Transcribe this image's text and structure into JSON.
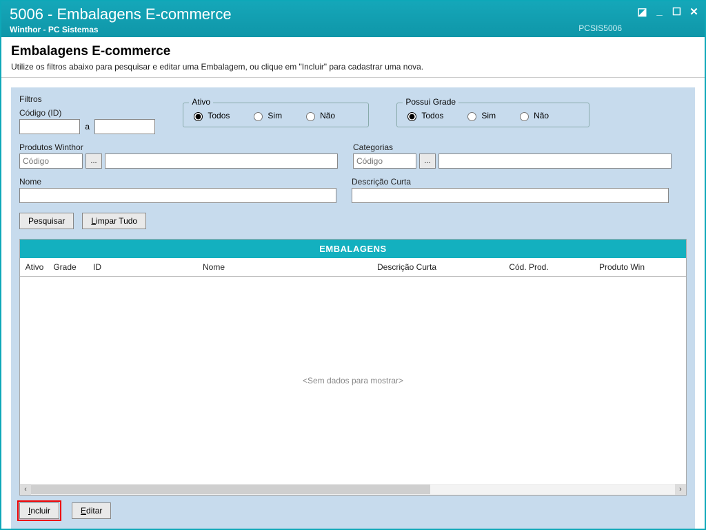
{
  "window": {
    "title": "5006 - Embalagens E-commerce",
    "subtitle": "Winthor - PC Sistemas",
    "module_code": "PCSIS5006"
  },
  "page": {
    "heading": "Embalagens E-commerce",
    "instruction": "Utilize os filtros abaixo para pesquisar e editar uma Embalagem, ou clique em \"Incluir\" para cadastrar uma nova."
  },
  "filters": {
    "legend": "Filtros",
    "codigo_label": "Código (ID)",
    "codigo_from": "",
    "codigo_sep": "a",
    "codigo_to": "",
    "ativo": {
      "legend": "Ativo",
      "options": {
        "todos": "Todos",
        "sim": "Sim",
        "nao": "Não"
      },
      "selected": "todos"
    },
    "grade": {
      "legend": "Possui Grade",
      "options": {
        "todos": "Todos",
        "sim": "Sim",
        "nao": "Não"
      },
      "selected": "todos"
    },
    "produtos": {
      "label": "Produtos Winthor",
      "code_placeholder": "Código",
      "code": "",
      "desc": ""
    },
    "categorias": {
      "label": "Categorias",
      "code_placeholder": "Código",
      "code": "",
      "desc": ""
    },
    "nome": {
      "label": "Nome",
      "value": ""
    },
    "descricao": {
      "label": "Descrição Curta",
      "value": ""
    },
    "buttons": {
      "pesquisar": "Pesquisar",
      "limpar": "Limpar Tudo"
    }
  },
  "grid": {
    "title": "EMBALAGENS",
    "columns": {
      "ativo": "Ativo",
      "grade": "Grade",
      "id": "ID",
      "nome": "Nome",
      "desc": "Descrição Curta",
      "cod": "Cód. Prod.",
      "prod": "Produto Win"
    },
    "no_data": "<Sem dados para mostrar>",
    "rows": []
  },
  "actions": {
    "incluir": "Incluir",
    "editar": "Editar"
  }
}
